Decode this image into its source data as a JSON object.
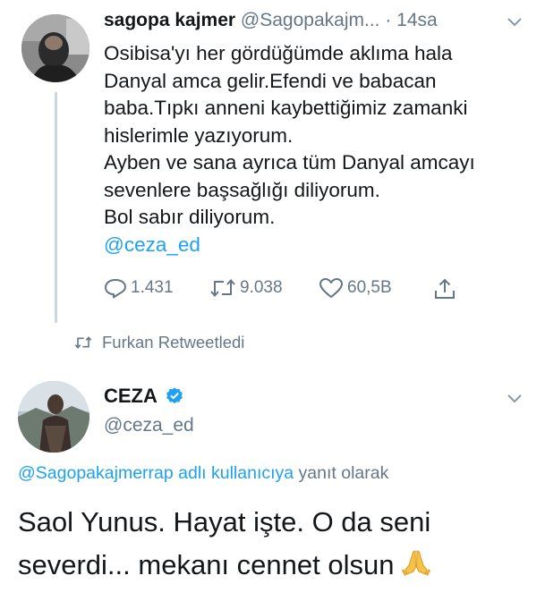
{
  "tweet1": {
    "author_name": "sagopa kajmer",
    "author_handle": "@Sagopakajm...",
    "time_sep": " · ",
    "time": "14sa",
    "lines": [
      "Osibisa'yı her gördüğümde aklıma hala",
      "Danyal amca gelir.Efendi ve babacan",
      "baba.Tıpkı anneni kaybettiğimiz zamanki",
      "hislerimle yazıyorum.",
      "Ayben ve sana ayrıca tüm Danyal amcayı",
      "sevenlere başsağlığı diliyorum.",
      "Bol sabır diliyorum."
    ],
    "mention": "@ceza_ed",
    "stats": {
      "replies": "1.431",
      "retweets": "9.038",
      "likes": "60,5B"
    }
  },
  "retweet_context": "Furkan Retweetledi",
  "tweet2": {
    "author_name": "CEZA",
    "author_handle": "@ceza_ed",
    "replying_mention": "@Sagopakajmerrap adlı kullanıcıya",
    "replying_suffix": " yanıt olarak",
    "lines": [
      "Saol Yunus. Hayat işte. O da seni",
      "severdi... mekanı cennet olsun"
    ]
  },
  "colors": {
    "accent": "#1da1f2",
    "secondary_text": "#657786",
    "text": "#14171a"
  },
  "icons": [
    "reply-icon",
    "retweet-icon",
    "like-icon",
    "share-icon",
    "verified-badge-icon",
    "chevron-down-icon",
    "folded-hands-emoji"
  ]
}
